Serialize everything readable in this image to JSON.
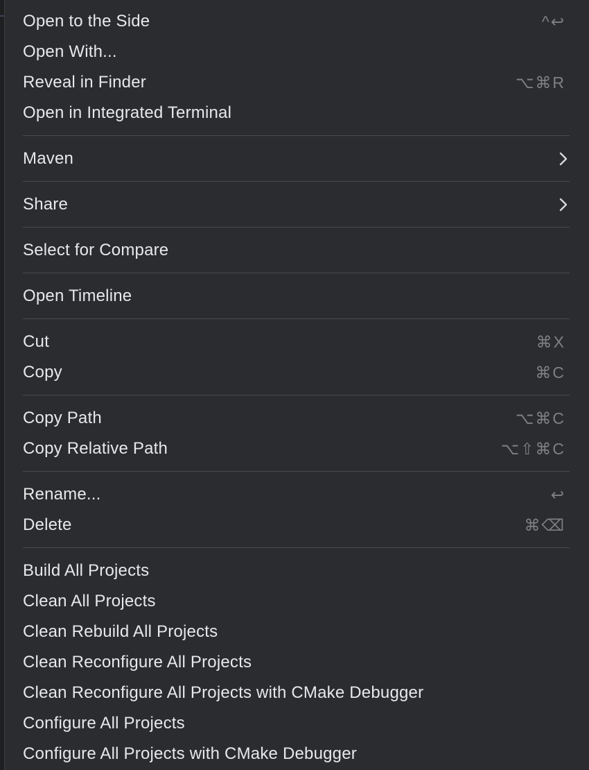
{
  "menu": {
    "groups": [
      {
        "items": [
          {
            "label": "Open to the Side",
            "shortcut": "^↩"
          },
          {
            "label": "Open With...",
            "shortcut": ""
          },
          {
            "label": "Reveal in Finder",
            "shortcut": "⌥⌘R"
          },
          {
            "label": "Open in Integrated Terminal",
            "shortcut": ""
          }
        ]
      },
      {
        "items": [
          {
            "label": "Maven",
            "submenu": true
          }
        ]
      },
      {
        "items": [
          {
            "label": "Share",
            "submenu": true
          }
        ]
      },
      {
        "items": [
          {
            "label": "Select for Compare",
            "shortcut": ""
          }
        ]
      },
      {
        "items": [
          {
            "label": "Open Timeline",
            "shortcut": ""
          }
        ]
      },
      {
        "items": [
          {
            "label": "Cut",
            "shortcut": "⌘X"
          },
          {
            "label": "Copy",
            "shortcut": "⌘C"
          }
        ]
      },
      {
        "items": [
          {
            "label": "Copy Path",
            "shortcut": "⌥⌘C"
          },
          {
            "label": "Copy Relative Path",
            "shortcut": "⌥⇧⌘C"
          }
        ]
      },
      {
        "items": [
          {
            "label": "Rename...",
            "shortcut": "↩"
          },
          {
            "label": "Delete",
            "shortcut": "⌘⌫"
          }
        ]
      },
      {
        "items": [
          {
            "label": "Build All Projects",
            "shortcut": ""
          },
          {
            "label": "Clean All Projects",
            "shortcut": ""
          },
          {
            "label": "Clean Rebuild All Projects",
            "shortcut": ""
          },
          {
            "label": "Clean Reconfigure All Projects",
            "shortcut": ""
          },
          {
            "label": "Clean Reconfigure All Projects with CMake Debugger",
            "shortcut": ""
          },
          {
            "label": "Configure All Projects",
            "shortcut": ""
          },
          {
            "label": "Configure All Projects with CMake Debugger",
            "shortcut": ""
          }
        ]
      }
    ]
  },
  "colors": {
    "menu_background": "#2b2c2f",
    "text": "#e8e8ea",
    "shortcut_text": "#7f8084",
    "separator": "#4a4b4f"
  },
  "icons": {
    "submenu": "chevron-right-icon"
  }
}
